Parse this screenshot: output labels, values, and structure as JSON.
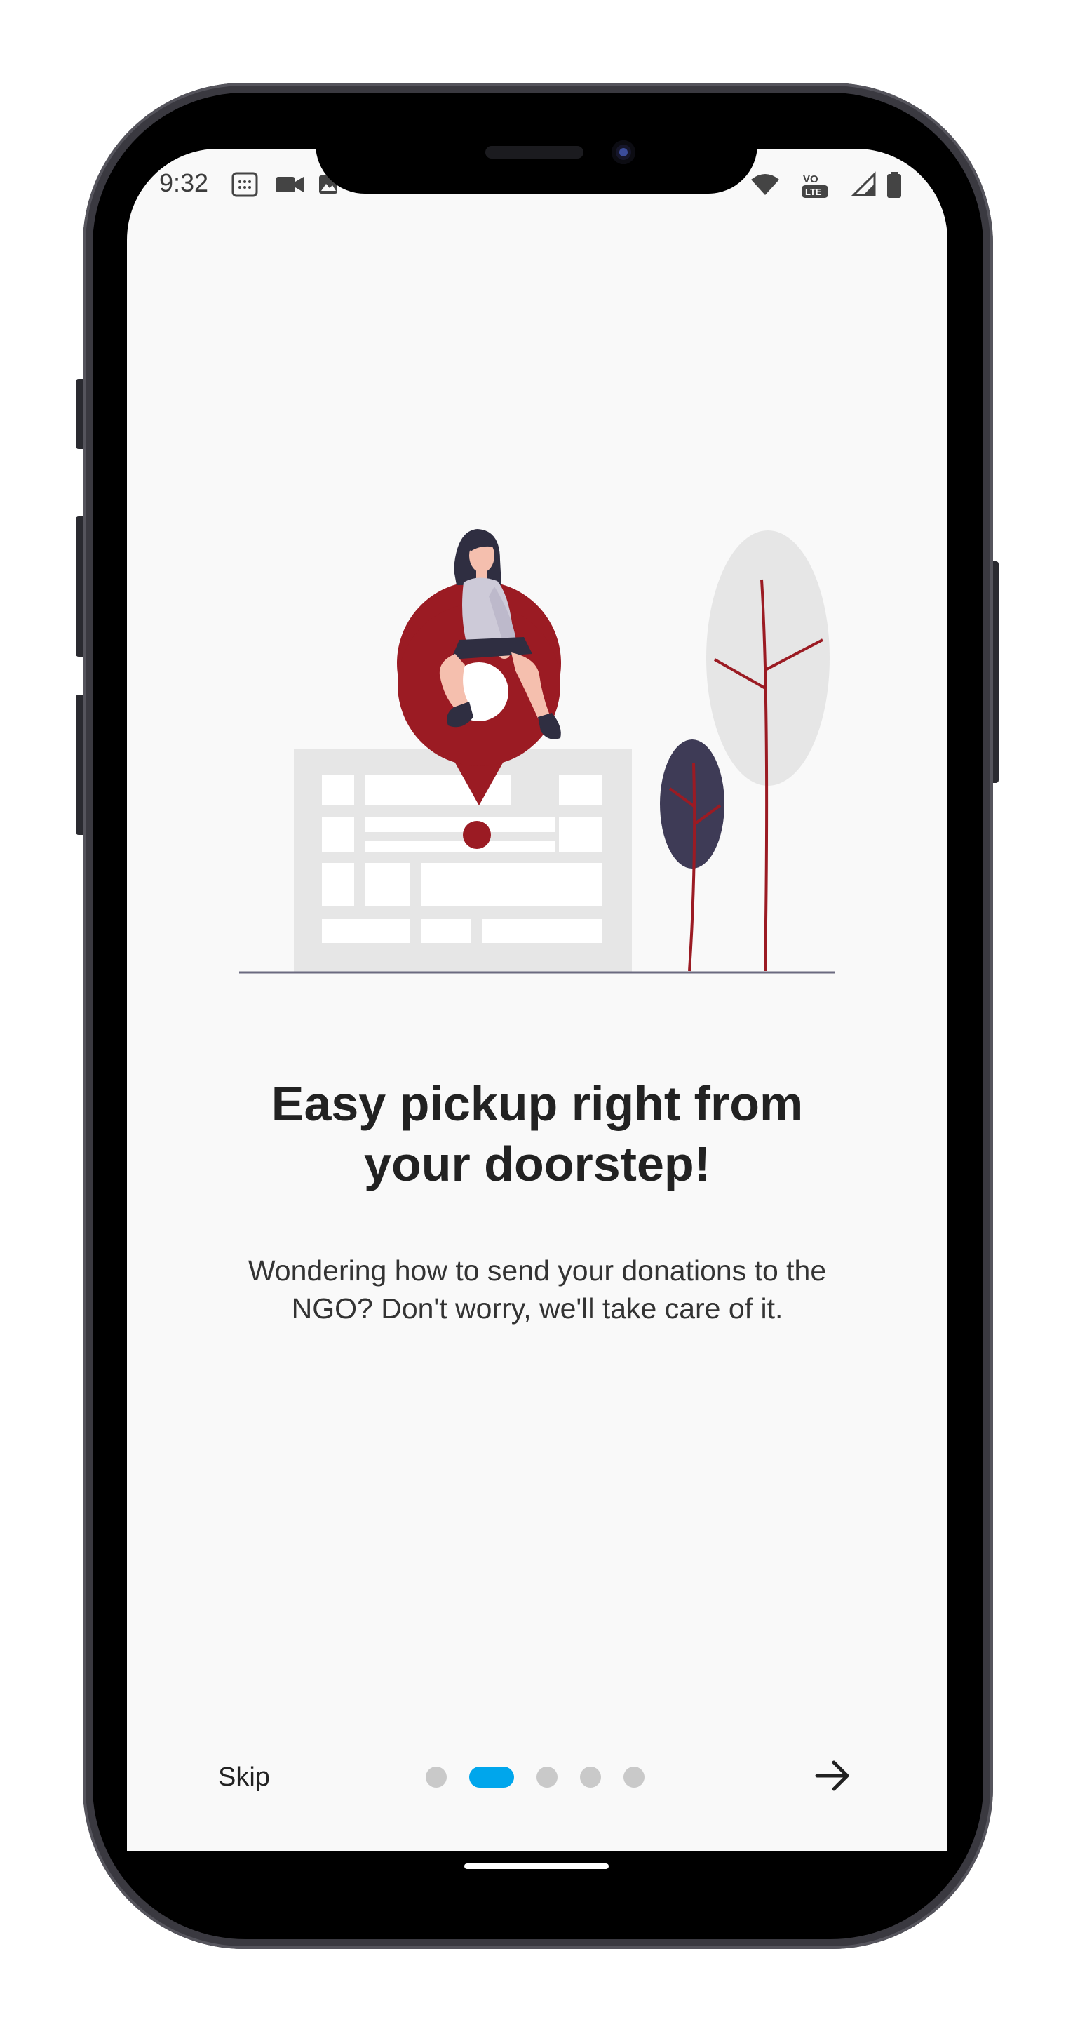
{
  "status_bar": {
    "time": "9:32",
    "icons": [
      "calendar-icon",
      "video-icon",
      "image-icon",
      "mute-icon",
      "wifi-icon",
      "volte-icon",
      "signal-icon",
      "battery-icon"
    ]
  },
  "onboarding": {
    "title": "Easy pickup right from your doorstep!",
    "subtitle": "Wondering how to send your donations to the NGO? Don't worry, we'll take care of it.",
    "skip_label": "Skip",
    "page_count": 5,
    "current_page": 2,
    "next_icon": "arrow-right-icon"
  },
  "colors": {
    "accent": "#00a6ec",
    "pin": "#9b1b23",
    "dark_tree": "#3e3b56",
    "light_tree": "#e6e6e6",
    "background": "#f9f9f9"
  }
}
